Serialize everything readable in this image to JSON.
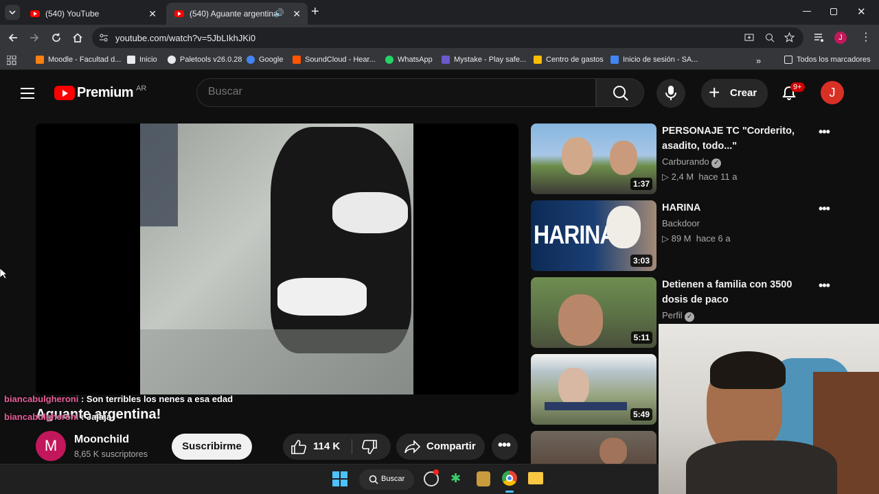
{
  "browser": {
    "tabs": [
      {
        "title": "(540) YouTube"
      },
      {
        "title": "(540) Aguante argentina! -"
      }
    ],
    "url": "youtube.com/watch?v=5JbLIkhJKi0",
    "bookmarks": [
      {
        "label": "Moodle - Facultad d...",
        "color": "#f98012"
      },
      {
        "label": "Inicio",
        "color": "#e8eaed"
      },
      {
        "label": "Paletools v26.0.28",
        "color": "#e8eaed"
      },
      {
        "label": "Google",
        "color": "#4285f4"
      },
      {
        "label": "SoundCloud - Hear...",
        "color": "#ff5500"
      },
      {
        "label": "WhatsApp",
        "color": "#25d366"
      },
      {
        "label": "Mystake - Play safe...",
        "color": "#6a5acd"
      },
      {
        "label": "Centro de gastos",
        "color": "#fbbc04"
      },
      {
        "label": "Inicio de sesión - SA...",
        "color": "#4285f4"
      }
    ],
    "all_bookmarks": "Todos los marcadores",
    "profile_initial": "J"
  },
  "youtube": {
    "logo_text": "Premium",
    "region": "AR",
    "search_placeholder": "Buscar",
    "create_label": "Crear",
    "notifications": "9+",
    "avatar_initial": "J"
  },
  "video": {
    "title": "Aguante argentina!",
    "channel": "Moonchild",
    "channel_initial": "M",
    "subscribers": "8,65 K suscriptores",
    "subscribe_label": "Suscribirme",
    "likes": "114 K",
    "share_label": "Compartir"
  },
  "chat": [
    {
      "user": "biancabulgheroni",
      "text": ": Son terribles los nenes a esa edad"
    },
    {
      "user": "biancabulgheroni",
      "text": ": Jajaja"
    }
  ],
  "recommendations": [
    {
      "title": "PERSONAJE TC \"Corderito, asadito, todo...\"",
      "channel": "Carburando",
      "verified": true,
      "views": "2,4 M",
      "age": "hace 11 a",
      "duration": "1:37",
      "thumb_color": "#4a7fb0"
    },
    {
      "title": "HARINA",
      "channel": "Backdoor",
      "verified": false,
      "views": "89 M",
      "age": "hace 6 a",
      "duration": "3:03",
      "thumb_color": "#1b3a6b",
      "thumb_text": "HARINA"
    },
    {
      "title": "Detienen a familia con 3500 dosis de paco",
      "channel": "Perfil",
      "verified": true,
      "views": "",
      "age": "",
      "duration": "5:11",
      "thumb_color": "#6b6e4a"
    },
    {
      "title": "",
      "channel": "",
      "verified": false,
      "views": "",
      "age": "",
      "duration": "5:49",
      "thumb_color": "#8c9aa3"
    },
    {
      "title": "",
      "channel": "",
      "verified": false,
      "views": "",
      "age": "",
      "duration": "",
      "thumb_color": "#5c4a3f"
    }
  ],
  "taskbar": {
    "search_label": "Buscar"
  }
}
